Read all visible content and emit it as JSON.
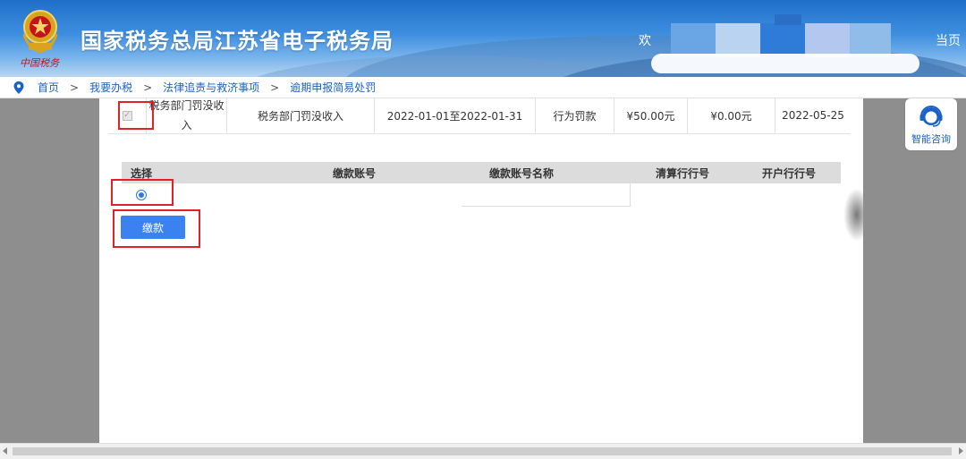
{
  "header": {
    "title": "国家税务总局江苏省电子税务局",
    "emblem_text": "中国税务",
    "welcome_left": "欢",
    "welcome_right": "当页"
  },
  "breadcrumb": {
    "items": [
      "首页",
      "我要办税",
      "法律追责与救济事项",
      "逾期申报简易处罚"
    ],
    "separator": ">"
  },
  "penalty_row": {
    "checkbox_checked": true,
    "type_line1": "税务部门罚没收",
    "type_line2": "入",
    "name": "税务部门罚没收入",
    "period": "2022-01-01至2022-01-31",
    "category": "行为罚款",
    "amount": "¥50.00元",
    "paid": "¥0.00元",
    "date": "2022-05-25"
  },
  "account_table": {
    "headers": {
      "select": "选择",
      "account_no": "缴款账号",
      "account_name": "缴款账号名称",
      "clearing_bank_no": "清算行行号",
      "bank_no": "开户行行号"
    },
    "selected": true
  },
  "actions": {
    "pay_label": "缴款"
  },
  "assistant": {
    "label": "智能咨询"
  },
  "colors": {
    "primary": "#3b82f0",
    "link": "#1a62c7",
    "highlight": "#e0212a"
  }
}
